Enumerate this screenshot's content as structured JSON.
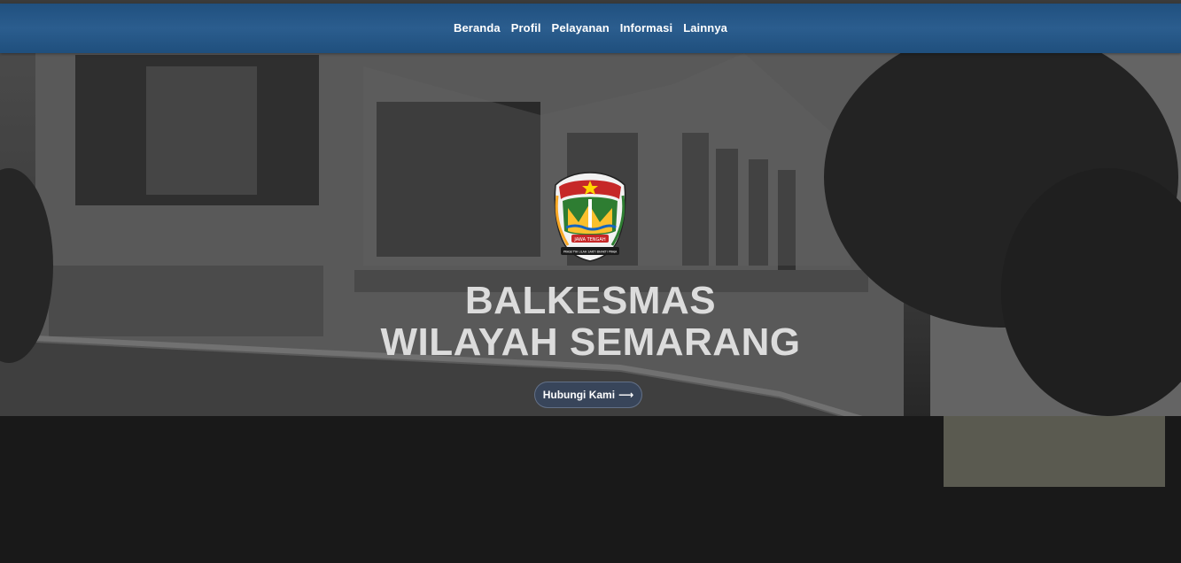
{
  "nav": {
    "items": [
      {
        "label": "Beranda"
      },
      {
        "label": "Profil"
      },
      {
        "label": "Pelayanan"
      },
      {
        "label": "Informasi"
      },
      {
        "label": "Lainnya"
      }
    ]
  },
  "hero": {
    "logo_icon": "jawa-tengah-emblem-icon",
    "logo_text": {
      "banner": "JAWA TENGAH",
      "motto": "PRASETYA ULAH SAKTI BHAKTI PRAJA"
    },
    "title_line1": "BALKESMAS",
    "title_line2": "WILAYAH SEMARANG",
    "cta_label": "Hubungi Kami",
    "cta_arrow": "⟶"
  },
  "colors": {
    "nav_bg": "#2b5d8e",
    "title": "#dcdcdc",
    "cta_bg": "#37465f"
  }
}
